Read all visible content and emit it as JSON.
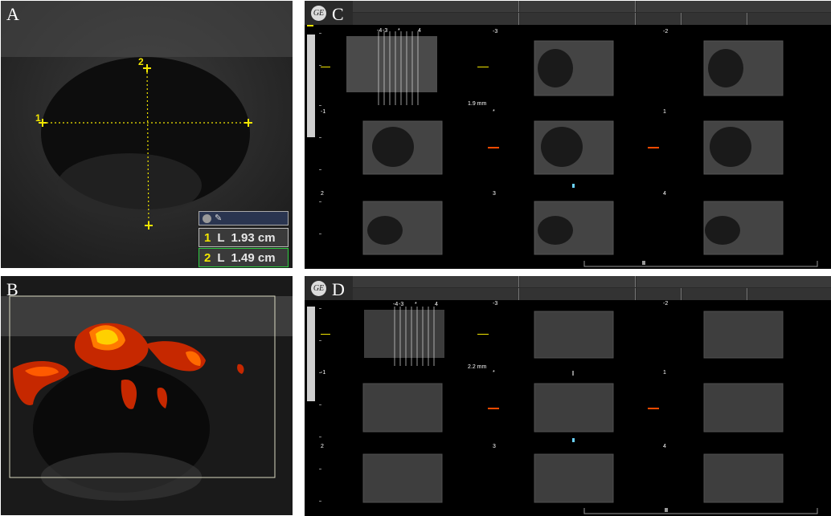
{
  "panels": {
    "A": {
      "letter": "A",
      "markers": {
        "m1": "1",
        "m2": "2"
      },
      "measurements": [
        {
          "num": "1",
          "label": "L",
          "value": "1.93 cm"
        },
        {
          "num": "2",
          "label": "L",
          "value": "1.49 cm"
        }
      ]
    },
    "B": {
      "letter": "B"
    },
    "C": {
      "letter": "C",
      "logo": "GE",
      "scale_ticks": [
        "-4",
        "-3",
        "*",
        "4"
      ],
      "slice_thickness": "1.9 mm",
      "slice_labels": [
        "-3",
        "-2",
        "*",
        "-1",
        "1",
        "2",
        "3",
        "4"
      ]
    },
    "D": {
      "letter": "D",
      "logo": "GE",
      "scale_ticks": [
        "-4",
        "-3",
        "*",
        "4"
      ],
      "slice_thickness": "2.2 mm",
      "slice_labels": [
        "-3",
        "-2",
        "*",
        "-1",
        "1",
        "2",
        "3",
        "4"
      ]
    }
  },
  "colors": {
    "caliper": "#f2e600",
    "doppler": "#ff4a00",
    "accent_green": "#2ecc40"
  }
}
